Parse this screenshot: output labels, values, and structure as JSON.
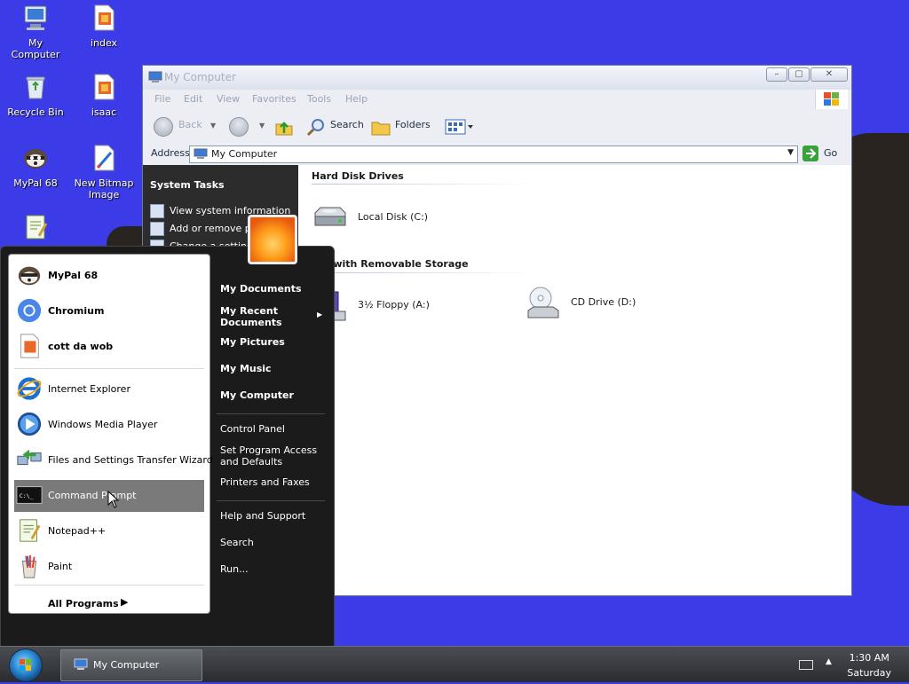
{
  "desktop": {
    "icons": [
      {
        "label": "My Computer",
        "icon": "my-computer-icon"
      },
      {
        "label": "index",
        "icon": "html-file-icon"
      },
      {
        "label": "Recycle Bin",
        "icon": "recycle-bin-icon"
      },
      {
        "label": "isaac",
        "icon": "html-file-icon"
      },
      {
        "label": "MyPal 68",
        "icon": "mypal-icon"
      },
      {
        "label": "New Bitmap Image",
        "icon": "bitmap-icon"
      }
    ]
  },
  "window": {
    "title": "My Computer",
    "menu": [
      "File",
      "Edit",
      "View",
      "Favorites",
      "Tools",
      "Help"
    ],
    "toolbar": {
      "back": "Back",
      "search": "Search",
      "folders": "Folders"
    },
    "address": {
      "label": "Address",
      "value": "My Computer",
      "go": "Go"
    },
    "task_pane": {
      "header": "System Tasks",
      "items": [
        "View system information",
        "Add or remove pr",
        "Change a setting"
      ]
    },
    "sections": {
      "hard_disks": "Hard Disk Drives",
      "removable": "ces with Removable Storage"
    },
    "drives": [
      {
        "label": "Local Disk (C:)"
      },
      {
        "label": "3½ Floppy (A:)"
      },
      {
        "label": "CD Drive (D:)"
      }
    ]
  },
  "start_menu": {
    "pinned": [
      "MyPal 68",
      "Chromium",
      "cott da wob"
    ],
    "recent": [
      "Internet Explorer",
      "Windows Media Player",
      "Files and Settings Transfer Wizard",
      "Command Prompt",
      "Notepad++",
      "Paint"
    ],
    "all_programs": "All Programs",
    "right": {
      "my_documents": "My Documents",
      "my_recent_1": "My Recent",
      "my_recent_2": "Documents",
      "my_pictures": "My Pictures",
      "my_music": "My Music",
      "my_computer": "My Computer",
      "control_panel": "Control Panel",
      "spad_1": "Set Program Access",
      "spad_2": "and Defaults",
      "printers": "Printers and Faxes",
      "help": "Help and Support",
      "search": "Search",
      "run": "Run..."
    }
  },
  "taskbar": {
    "task": "My Computer",
    "time": "1:30 AM",
    "day": "Saturday"
  }
}
